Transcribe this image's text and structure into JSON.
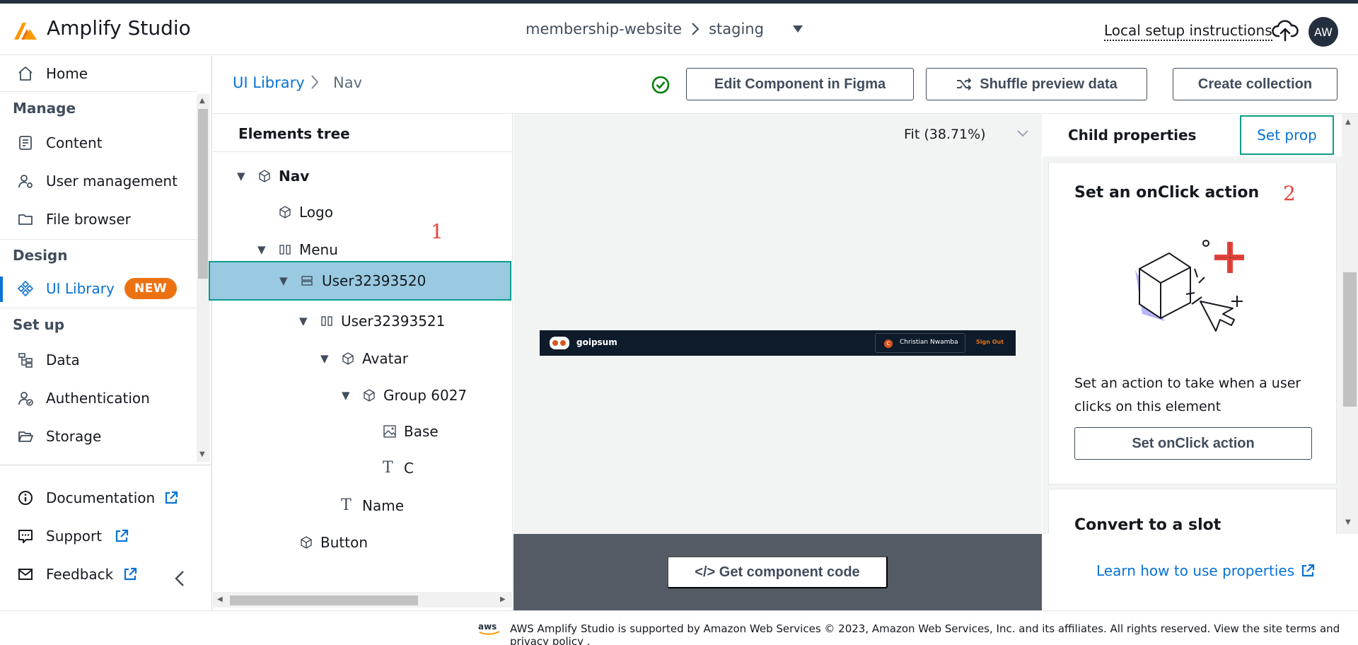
{
  "header": {
    "app_title": "Amplify Studio",
    "project": "membership-website",
    "environment": "staging",
    "local_setup": "Local setup instructions",
    "avatar_initials": "AW"
  },
  "sidebar": {
    "home": "Home",
    "sections": {
      "manage": "Manage",
      "design": "Design",
      "setup": "Set up"
    },
    "manage_items": [
      "Content",
      "User management",
      "File browser"
    ],
    "design_items": [
      "UI Library"
    ],
    "new_badge": "NEW",
    "setup_items": [
      "Data",
      "Authentication",
      "Storage"
    ],
    "footer_items": [
      "Documentation",
      "Support",
      "Feedback"
    ],
    "active": "UI Library"
  },
  "toolbar": {
    "breadcrumb_root": "UI Library",
    "breadcrumb_current": "Nav",
    "edit_figma": "Edit Component in Figma",
    "shuffle": "Shuffle preview data",
    "create_collection": "Create collection"
  },
  "tree": {
    "title": "Elements tree",
    "nodes": [
      "Nav",
      "Logo",
      "Menu",
      "User32393520",
      "User32393521",
      "Avatar",
      "Group 6027",
      "Base",
      "C",
      "Name",
      "Button"
    ],
    "selected": "User32393520"
  },
  "annotations": {
    "one": "1",
    "two": "2"
  },
  "canvas": {
    "zoom": "Fit (38.71%)",
    "preview": {
      "brand": "goipsum",
      "avatar_letter": "C",
      "user_name": "Christian Nwamba",
      "sign_out": "Sign Out"
    },
    "get_code": "</> Get component code"
  },
  "properties": {
    "title": "Child properties",
    "set_prop": "Set prop",
    "onclick_title": "Set an onClick action",
    "onclick_desc": "Set an action to take when a user clicks on this element",
    "onclick_button": "Set onClick action",
    "slot_title": "Convert to a slot",
    "learn": "Learn how to use properties"
  },
  "footer": {
    "text": "AWS Amplify Studio is supported by Amazon Web Services © 2023, Amazon Web Services, Inc. and its affiliates. All rights reserved. View the site terms and privacy policy ."
  },
  "colors": {
    "accent": "#0972d3",
    "badge": "#ec7211",
    "selected_row": "#99cae2",
    "highlight_border": "#0f9d8c",
    "annotation": "#e8433b"
  }
}
